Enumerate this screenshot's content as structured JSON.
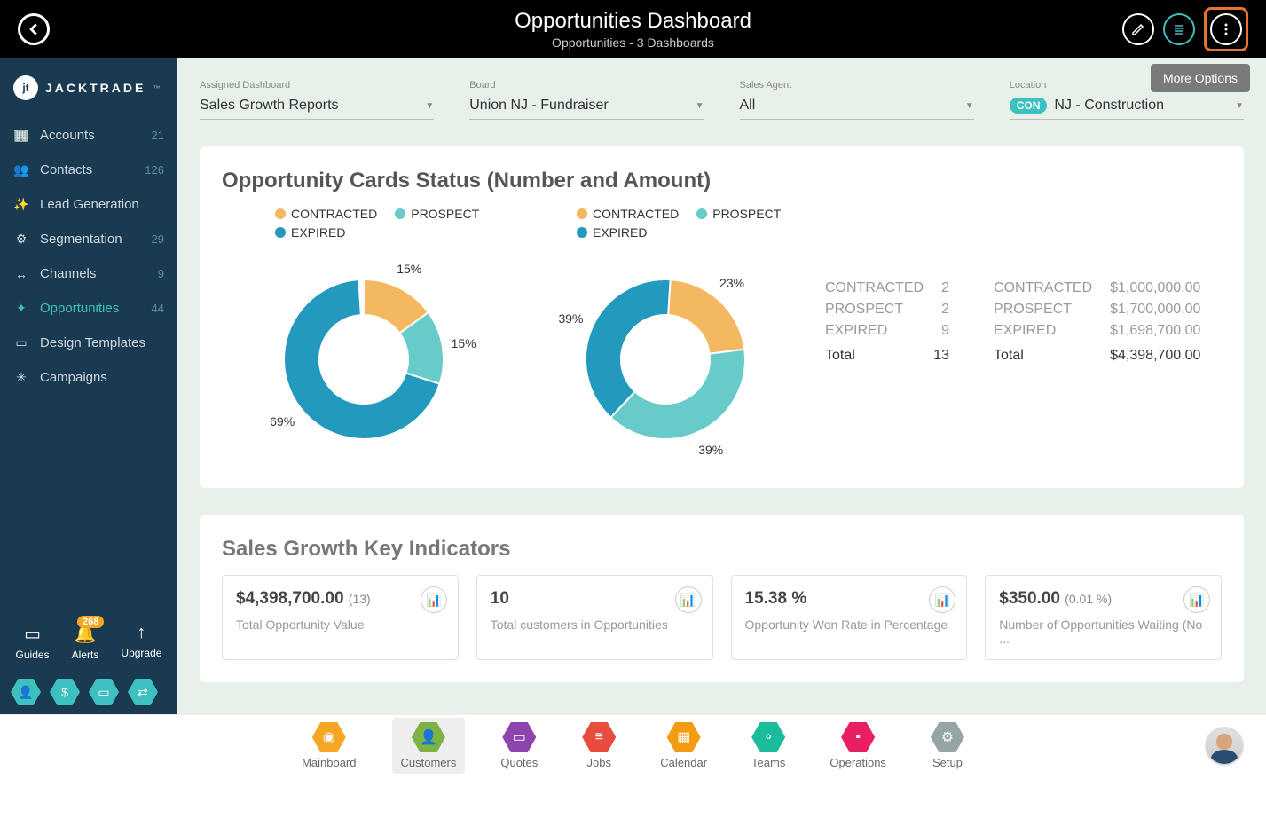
{
  "header": {
    "title": "Opportunities Dashboard",
    "subtitle": "Opportunities - 3 Dashboards",
    "tooltip": "More Options"
  },
  "brand": {
    "mark": "jt",
    "name": "JACKTRADE",
    "tm": "™"
  },
  "sidebar": {
    "items": [
      {
        "icon": "🏢",
        "label": "Accounts",
        "count": "21"
      },
      {
        "icon": "👥",
        "label": "Contacts",
        "count": "126"
      },
      {
        "icon": "✨",
        "label": "Lead Generation",
        "count": ""
      },
      {
        "icon": "⚙",
        "label": "Segmentation",
        "count": "29"
      },
      {
        "icon": "↔",
        "label": "Channels",
        "count": "9"
      },
      {
        "icon": "✦",
        "label": "Opportunities",
        "count": "44"
      },
      {
        "icon": "▭",
        "label": "Design Templates",
        "count": ""
      },
      {
        "icon": "✳",
        "label": "Campaigns",
        "count": ""
      }
    ],
    "tools": [
      {
        "icon": "▭",
        "label": "Guides",
        "badge": ""
      },
      {
        "icon": "🔔",
        "label": "Alerts",
        "badge": "268"
      },
      {
        "icon": "↑",
        "label": "Upgrade",
        "badge": ""
      }
    ],
    "hex": [
      "👤",
      "$",
      "▭",
      "⇄"
    ]
  },
  "filters": [
    {
      "label": "Assigned Dashboard",
      "value": "Sales Growth Reports"
    },
    {
      "label": "Board",
      "value": "Union NJ - Fundraiser"
    },
    {
      "label": "Sales Agent",
      "value": "All"
    },
    {
      "label": "Location",
      "value": "NJ - Construction",
      "badge": "CON"
    }
  ],
  "card1": {
    "title": "Opportunity Cards Status (Number and Amount)",
    "legend": [
      {
        "color": "#f4b860",
        "label": "CONTRACTED"
      },
      {
        "color": "#67cbc9",
        "label": "PROSPECT"
      },
      {
        "color": "#2299bd",
        "label": "EXPIRED"
      }
    ],
    "stats_num": [
      {
        "label": "CONTRACTED",
        "val": "2"
      },
      {
        "label": "PROSPECT",
        "val": "2"
      },
      {
        "label": "EXPIRED",
        "val": "9"
      }
    ],
    "stats_num_total": {
      "label": "Total",
      "val": "13"
    },
    "stats_amt": [
      {
        "label": "CONTRACTED",
        "val": "$1,000,000.00"
      },
      {
        "label": "PROSPECT",
        "val": "$1,700,000.00"
      },
      {
        "label": "EXPIRED",
        "val": "$1,698,700.00"
      }
    ],
    "stats_amt_total": {
      "label": "Total",
      "val": "$4,398,700.00"
    }
  },
  "chart_data": [
    {
      "type": "pie",
      "title": "Number",
      "series": [
        {
          "name": "CONTRACTED",
          "value": 15,
          "color": "#f4b860"
        },
        {
          "name": "PROSPECT",
          "value": 15,
          "color": "#67cbc9"
        },
        {
          "name": "EXPIRED",
          "value": 69,
          "color": "#2299bd"
        }
      ]
    },
    {
      "type": "pie",
      "title": "Amount",
      "series": [
        {
          "name": "CONTRACTED",
          "value": 23,
          "color": "#f4b860"
        },
        {
          "name": "PROSPECT",
          "value": 39,
          "color": "#67cbc9"
        },
        {
          "name": "EXPIRED",
          "value": 39,
          "color": "#2299bd"
        }
      ]
    }
  ],
  "card2": {
    "title": "Sales Growth Key Indicators",
    "kpis": [
      {
        "value": "$4,398,700.00",
        "sub": "(13)",
        "label": "Total Opportunity Value"
      },
      {
        "value": "10",
        "sub": "",
        "label": "Total customers in Opportunities"
      },
      {
        "value": "15.38 %",
        "sub": "",
        "label": "Opportunity Won Rate in Percentage"
      },
      {
        "value": "$350.00",
        "sub": "(0.01 %)",
        "label": "Number of Opportunities Waiting (No ..."
      }
    ]
  },
  "bottombar": {
    "items": [
      {
        "color": "#f5a623",
        "icon": "◉",
        "label": "Mainboard"
      },
      {
        "color": "#7cb342",
        "icon": "👤",
        "label": "Customers"
      },
      {
        "color": "#8e44ad",
        "icon": "▭",
        "label": "Quotes"
      },
      {
        "color": "#e74c3c",
        "icon": "≡",
        "label": "Jobs"
      },
      {
        "color": "#f39c12",
        "icon": "▦",
        "label": "Calendar"
      },
      {
        "color": "#1abc9c",
        "icon": "⚬",
        "label": "Teams"
      },
      {
        "color": "#e91e63",
        "icon": "▪",
        "label": "Operations"
      },
      {
        "color": "#95a5a6",
        "icon": "⚙",
        "label": "Setup"
      }
    ]
  }
}
